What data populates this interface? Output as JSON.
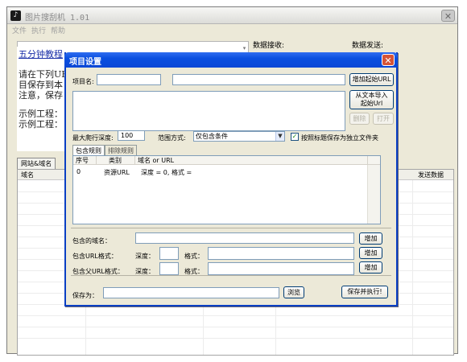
{
  "main_window": {
    "title": "图片搜刮机 1.01",
    "close_glyph": "✕",
    "menu": [
      "文件",
      "执行",
      "帮助"
    ],
    "top_labels": {
      "recv": "数据接收:",
      "send": "数据发送:"
    }
  },
  "info_panel": {
    "link": "五分钟教程",
    "lines": [
      "请在下列URL",
      "目保存到本",
      "注意，保存",
      "示例工程：",
      "示例工程："
    ]
  },
  "main_tabs": [
    "网站&域名"
  ],
  "grid": {
    "col_domain": "域名",
    "col_send": "发送数据"
  },
  "dialog": {
    "title": "项目设置",
    "close_glyph": "✕",
    "project_name_label": "项目名:",
    "project_name_value": "",
    "start_url_value": "",
    "btn_add_start_url": "增加起始URL",
    "btn_import_line1": "从文本导入",
    "btn_import_line2": "起始Url",
    "btn_delete": "删除",
    "btn_open": "打开",
    "max_depth_label": "最大爬行深度:",
    "max_depth_value": "100",
    "scope_label": "范围方式:",
    "scope_value": "仅包含条件",
    "save_by_title_label": "按照标题保存为独立文件夹",
    "save_by_title_checked": true,
    "tab_include": "包含规则",
    "tab_exclude": "排除规则",
    "rules": {
      "columns": [
        "序号",
        "类别",
        "域名 or URL"
      ],
      "rows": [
        {
          "index": "0",
          "type": "资源URL",
          "value": "深度 = 0, 格式 ="
        }
      ]
    },
    "contain_domain_label": "包含的域名：",
    "contain_url_label": "包含URL格式：",
    "contain_parent_url_label": "包含父URL格式：",
    "depth_label": "深度：",
    "format_label": "格式：",
    "btn_add": "增加",
    "save_as_label": "保存为：",
    "save_as_value": "",
    "btn_browse": "浏览",
    "btn_save_run": "保存并执行!"
  }
}
